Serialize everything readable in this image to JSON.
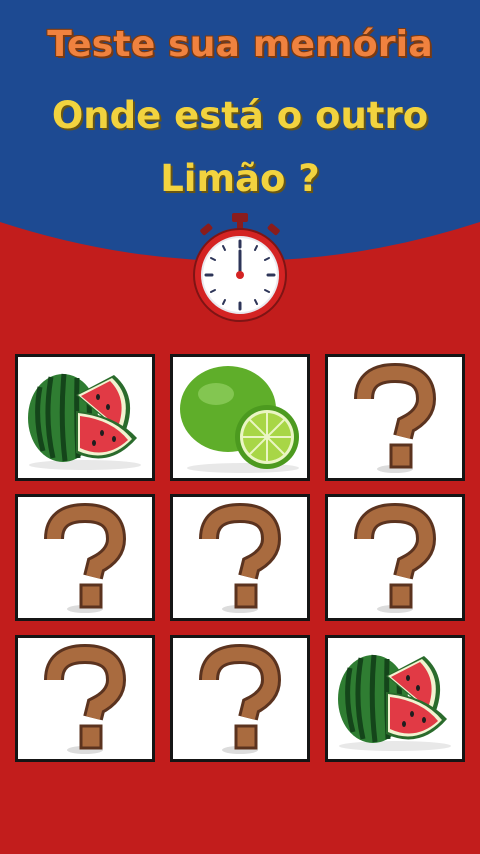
{
  "header": {
    "title": "Teste sua memória",
    "question_line1": "Onde está o outro",
    "question_line2": "Limão ?"
  },
  "colors": {
    "top_background": "#1d4a92",
    "bottom_background": "#c21d1c",
    "title": "#f0823f",
    "question": "#f2d33f"
  },
  "timer": {
    "icon": "stopwatch-icon"
  },
  "grid": {
    "rows": 3,
    "cols": 3,
    "cards": [
      {
        "content": "watermelon",
        "revealed": true
      },
      {
        "content": "lime",
        "revealed": true
      },
      {
        "content": "question-mark",
        "revealed": false
      },
      {
        "content": "question-mark",
        "revealed": false
      },
      {
        "content": "question-mark",
        "revealed": false
      },
      {
        "content": "question-mark",
        "revealed": false
      },
      {
        "content": "question-mark",
        "revealed": false
      },
      {
        "content": "question-mark",
        "revealed": false
      },
      {
        "content": "watermelon",
        "revealed": true
      }
    ]
  }
}
